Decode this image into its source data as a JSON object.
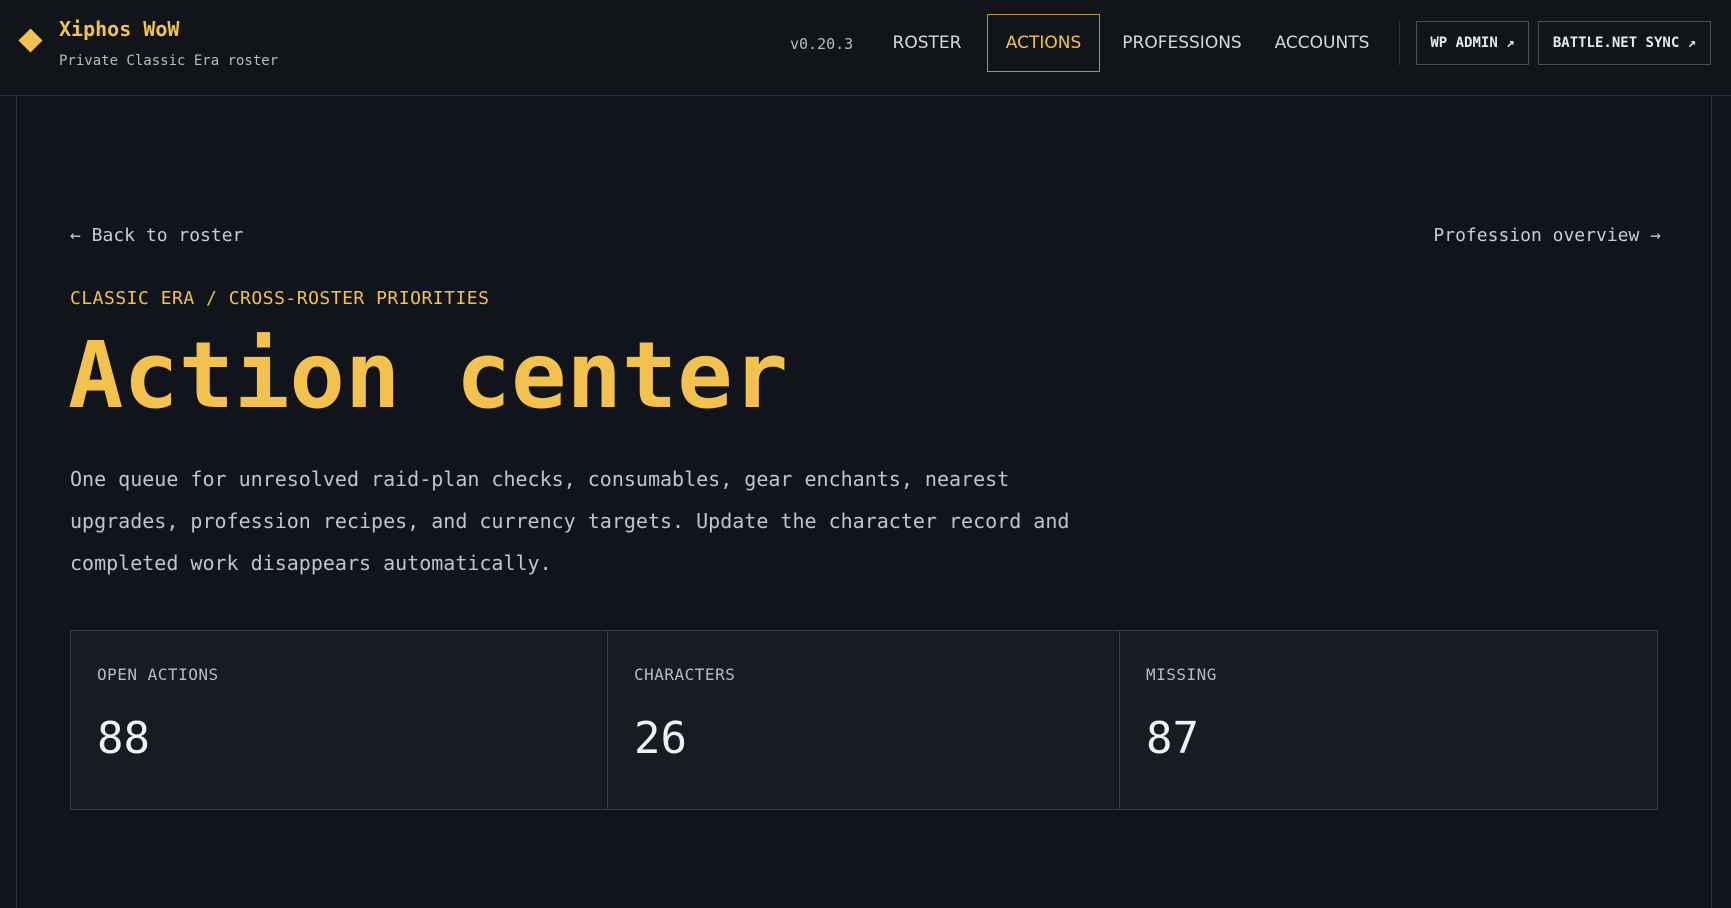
{
  "header": {
    "brand_title": "Xiphos WoW",
    "brand_subtitle": "Private Classic Era roster",
    "version": "v0.20.3",
    "nav": [
      {
        "label": "ROSTER",
        "active": false
      },
      {
        "label": "ACTIONS",
        "active": true
      },
      {
        "label": "PROFESSIONS",
        "active": false
      },
      {
        "label": "ACCOUNTS",
        "active": false
      }
    ],
    "wp_admin": "WP ADMIN ↗",
    "battlenet_sync": "BATTLE.NET SYNC ↗"
  },
  "main": {
    "back_link": "← Back to roster",
    "profession_link": "Profession overview →",
    "eyebrow": "CLASSIC ERA / CROSS-ROSTER PRIORITIES",
    "title": "Action center",
    "intro": "One queue for unresolved raid-plan checks, consumables, gear enchants, nearest upgrades, profession recipes, and currency targets. Update the character record and completed work disappears automatically.",
    "stats": [
      {
        "label": "OPEN ACTIONS",
        "value": "88"
      },
      {
        "label": "CHARACTERS",
        "value": "26"
      },
      {
        "label": "MISSING",
        "value": "87"
      }
    ]
  },
  "colors": {
    "accent": "#f2c14e",
    "background": "#11141a"
  }
}
